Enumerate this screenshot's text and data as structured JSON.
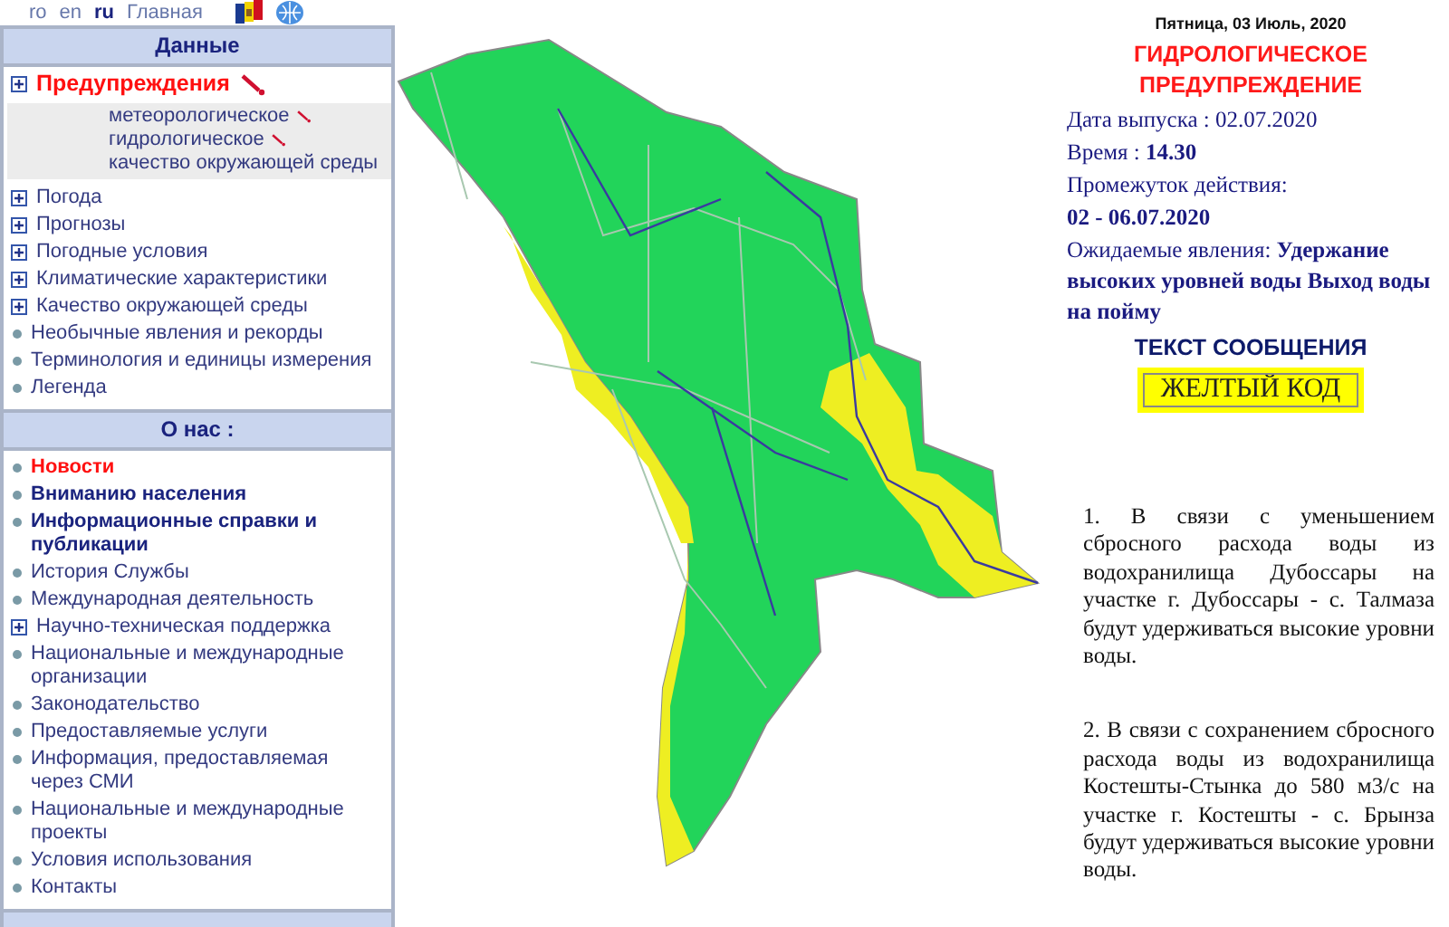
{
  "top_links": [
    {
      "label": "ro",
      "selected": false
    },
    {
      "label": "en",
      "selected": false
    },
    {
      "label": "ru",
      "selected": true
    },
    {
      "label": "Главная",
      "selected": false
    }
  ],
  "sidebar": {
    "sections": [
      {
        "title": "Данные",
        "items": [
          {
            "label": "Предупреждения",
            "kind": "expandable",
            "highlighted": true,
            "bold": true,
            "flagged": true,
            "children": [
              {
                "label": "метеорологическое",
                "flagged": true
              },
              {
                "label": "гидрологическое",
                "flagged": true
              },
              {
                "label": "качество окружающей среды",
                "flagged": false
              }
            ]
          },
          {
            "label": "Погода",
            "kind": "expandable",
            "highlighted": false,
            "bold": false,
            "flagged": false
          },
          {
            "label": "Прогнозы",
            "kind": "expandable",
            "highlighted": false,
            "bold": false,
            "flagged": false
          },
          {
            "label": "Погодные условия",
            "kind": "expandable",
            "highlighted": false,
            "bold": false,
            "flagged": false
          },
          {
            "label": "Климатические характеристики",
            "kind": "expandable",
            "highlighted": false,
            "bold": false,
            "flagged": false
          },
          {
            "label": "Качество окружающей среды",
            "kind": "expandable",
            "highlighted": false,
            "bold": false,
            "flagged": false
          },
          {
            "label": "Необычные явления и рекорды",
            "kind": "bullet",
            "highlighted": false,
            "bold": false,
            "flagged": false
          },
          {
            "label": "Терминология и единицы измерения",
            "kind": "bullet",
            "highlighted": false,
            "bold": false,
            "flagged": false
          },
          {
            "label": "Легенда",
            "kind": "bullet",
            "highlighted": false,
            "bold": false,
            "flagged": false
          }
        ]
      },
      {
        "title": "О нас :",
        "items": [
          {
            "label": "Новости",
            "kind": "bullet",
            "highlighted": true,
            "bold": true,
            "flagged": false
          },
          {
            "label": "Вниманию населения",
            "kind": "bullet",
            "highlighted": false,
            "bold": true,
            "flagged": false
          },
          {
            "label": "Информационные справки и публикации",
            "kind": "bullet",
            "highlighted": false,
            "bold": true,
            "flagged": false
          },
          {
            "label": "История Службы",
            "kind": "bullet",
            "highlighted": false,
            "bold": false,
            "flagged": false
          },
          {
            "label": "Международная деятельность",
            "kind": "bullet",
            "highlighted": false,
            "bold": false,
            "flagged": false
          },
          {
            "label": "Научно-техническая поддержка",
            "kind": "expandable",
            "highlighted": false,
            "bold": false,
            "flagged": false
          },
          {
            "label": "Национальные и международные организации",
            "kind": "bullet",
            "highlighted": false,
            "bold": false,
            "flagged": false
          },
          {
            "label": "Законодательство",
            "kind": "bullet",
            "highlighted": false,
            "bold": false,
            "flagged": false
          },
          {
            "label": "Предоставляемые услуги",
            "kind": "bullet",
            "highlighted": false,
            "bold": false,
            "flagged": false
          },
          {
            "label": "Информация, предоставляемая через СМИ",
            "kind": "bullet",
            "highlighted": false,
            "bold": false,
            "flagged": false
          },
          {
            "label": "Национальные и международные проекты",
            "kind": "bullet",
            "highlighted": false,
            "bold": false,
            "flagged": false
          },
          {
            "label": "Условия использования",
            "kind": "bullet",
            "highlighted": false,
            "bold": false,
            "flagged": false
          },
          {
            "label": "Контакты",
            "kind": "bullet",
            "highlighted": false,
            "bold": false,
            "flagged": false
          }
        ]
      }
    ]
  },
  "warning": {
    "date": "Пятница, 03 Июль, 2020",
    "title": "ГИДРОЛОГИЧЕСКОЕ ПРЕДУПРЕЖДЕНИЕ",
    "fields": [
      "Дата выпуска : 02.07.2020",
      "Время : **14.30**",
      "Промежуток действия:",
      "**02 - 06.07.2020**",
      "Ожидаемые явления: **Удержание высоких уровней воды Выход воды на пойму**"
    ],
    "message_heading": "ТЕКСТ СООБЩЕНИЯ",
    "code": {
      "label": "ЖЕЛТЫЙ КОД",
      "color": "#ffff00"
    },
    "paragraphs": [
      "1. В связи с уменьшением сбросного расхода воды из водохранилища Дубоссары на участке г. Дубоссары - с. Талмаза будут удерживаться высокие уровни воды.",
      "2. В связи с сохранением сбросного расхода воды из водохранилища Костешты-Стынка до 580 м3/с на участке г. Костешты - с. Брынза будут удерживаться высокие уровни воды."
    ]
  }
}
